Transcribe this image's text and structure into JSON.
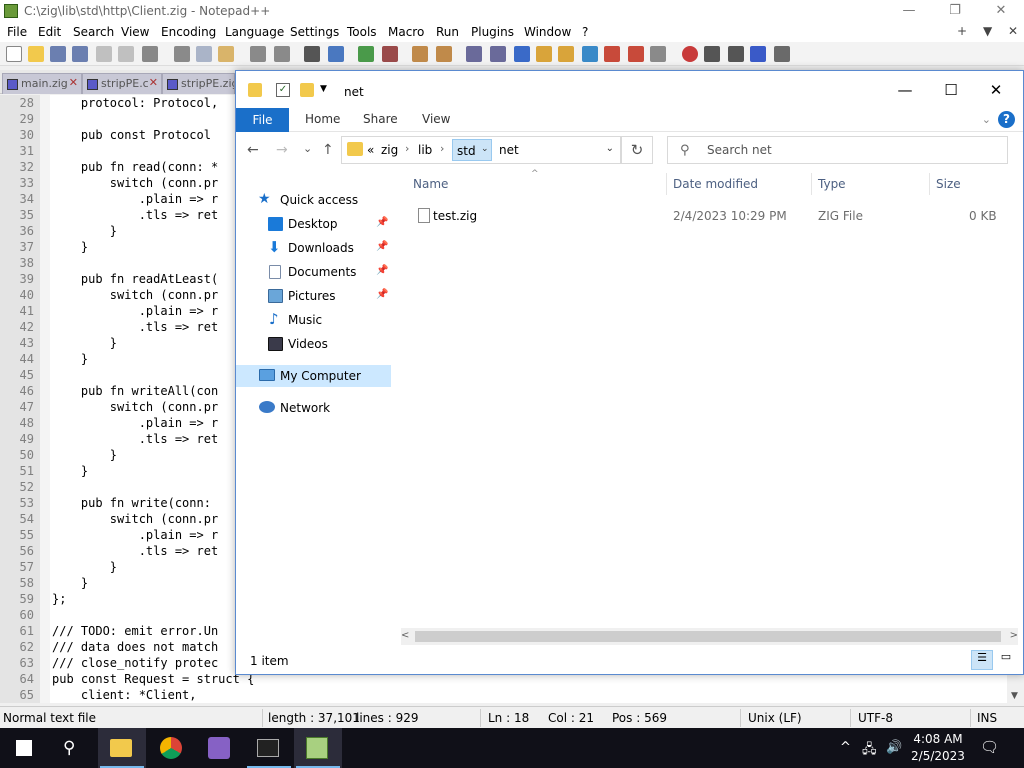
{
  "npp": {
    "title": "C:\\zig\\lib\\std\\http\\Client.zig - Notepad++",
    "menu": [
      "File",
      "Edit",
      "Search",
      "View",
      "Encoding",
      "Language",
      "Settings",
      "Tools",
      "Macro",
      "Run",
      "Plugins",
      "Window",
      "?"
    ],
    "menu_right": [
      "+",
      "▼",
      "✕"
    ],
    "tabs": [
      {
        "label": "main.zig",
        "close": "✕"
      },
      {
        "label": "stripPE.c",
        "close": "✕"
      },
      {
        "label": "stripPE.zig",
        "close": ""
      }
    ],
    "lines": [
      {
        "n": "28",
        "t": "    protocol: Protocol,"
      },
      {
        "n": "29",
        "t": ""
      },
      {
        "n": "30",
        "t": "    pub const Protocol"
      },
      {
        "n": "31",
        "t": ""
      },
      {
        "n": "32",
        "t": "    pub fn read(conn: *"
      },
      {
        "n": "33",
        "t": "        switch (conn.pr"
      },
      {
        "n": "34",
        "t": "            .plain => r"
      },
      {
        "n": "35",
        "t": "            .tls => ret"
      },
      {
        "n": "36",
        "t": "        }"
      },
      {
        "n": "37",
        "t": "    }"
      },
      {
        "n": "38",
        "t": ""
      },
      {
        "n": "39",
        "t": "    pub fn readAtLeast("
      },
      {
        "n": "40",
        "t": "        switch (conn.pr"
      },
      {
        "n": "41",
        "t": "            .plain => r"
      },
      {
        "n": "42",
        "t": "            .tls => ret"
      },
      {
        "n": "43",
        "t": "        }"
      },
      {
        "n": "44",
        "t": "    }"
      },
      {
        "n": "45",
        "t": ""
      },
      {
        "n": "46",
        "t": "    pub fn writeAll(con"
      },
      {
        "n": "47",
        "t": "        switch (conn.pr"
      },
      {
        "n": "48",
        "t": "            .plain => r"
      },
      {
        "n": "49",
        "t": "            .tls => ret"
      },
      {
        "n": "50",
        "t": "        }"
      },
      {
        "n": "51",
        "t": "    }"
      },
      {
        "n": "52",
        "t": ""
      },
      {
        "n": "53",
        "t": "    pub fn write(conn: "
      },
      {
        "n": "54",
        "t": "        switch (conn.pr"
      },
      {
        "n": "55",
        "t": "            .plain => r"
      },
      {
        "n": "56",
        "t": "            .tls => ret"
      },
      {
        "n": "57",
        "t": "        }"
      },
      {
        "n": "58",
        "t": "    }"
      },
      {
        "n": "59",
        "t": "};"
      },
      {
        "n": "60",
        "t": ""
      },
      {
        "n": "61",
        "t": "/// TODO: emit error.Un"
      },
      {
        "n": "62",
        "t": "/// data does not match"
      },
      {
        "n": "63",
        "t": "/// close_notify protec"
      },
      {
        "n": "64",
        "t": "pub const Request = struct {"
      },
      {
        "n": "65",
        "t": "    client: *Client,"
      }
    ],
    "status": {
      "mode": "Normal text file",
      "length": "length : 37,101",
      "lines": "lines : 929",
      "ln": "Ln : 18",
      "col": "Col : 21",
      "pos": "Pos : 569",
      "eol": "Unix (LF)",
      "enc": "UTF-8",
      "ins": "INS"
    }
  },
  "explorer": {
    "title": "net",
    "window_controls": [
      "—",
      "☐",
      "✕"
    ],
    "ribbon": {
      "file": "File",
      "home": "Home",
      "share": "Share",
      "view": "View",
      "help": "?",
      "expand": "⌄"
    },
    "nav": {
      "back": "←",
      "forward": "→",
      "recent": "⌄",
      "up": "↑",
      "refresh": "↻"
    },
    "address": {
      "overflow": "«",
      "sep": "›",
      "crumbs": [
        "zig",
        "lib",
        "std",
        "net"
      ],
      "dropdown_arrow": "⌄",
      "history": "⌄"
    },
    "search": {
      "placeholder": "Search net",
      "icon": "⚲"
    },
    "navpane": {
      "quick_access": "Quick access",
      "items": [
        {
          "label": "Desktop",
          "pinned": true
        },
        {
          "label": "Downloads",
          "pinned": true
        },
        {
          "label": "Documents",
          "pinned": true
        },
        {
          "label": "Pictures",
          "pinned": true
        },
        {
          "label": "Music",
          "pinned": false
        },
        {
          "label": "Videos",
          "pinned": false
        }
      ],
      "pin_glyph": "📌",
      "my_computer": "My Computer",
      "network": "Network"
    },
    "columns": {
      "name": "Name",
      "date": "Date modified",
      "type": "Type",
      "size": "Size",
      "sort_glyph": "^"
    },
    "files": [
      {
        "name": "test.zig",
        "date": "2/4/2023 10:29 PM",
        "type": "ZIG File",
        "size": "0 KB"
      }
    ],
    "status": "1 item",
    "scroll": {
      "left": "<",
      "right": ">"
    }
  },
  "taskbar": {
    "clock_time": "4:08 AM",
    "clock_date": "2/5/2023",
    "tray": [
      "^",
      "🖧",
      "🔊"
    ]
  },
  "colors": {
    "accent": "#1a6fc9",
    "selection": "#cce8ff",
    "taskbar": "#101018"
  }
}
